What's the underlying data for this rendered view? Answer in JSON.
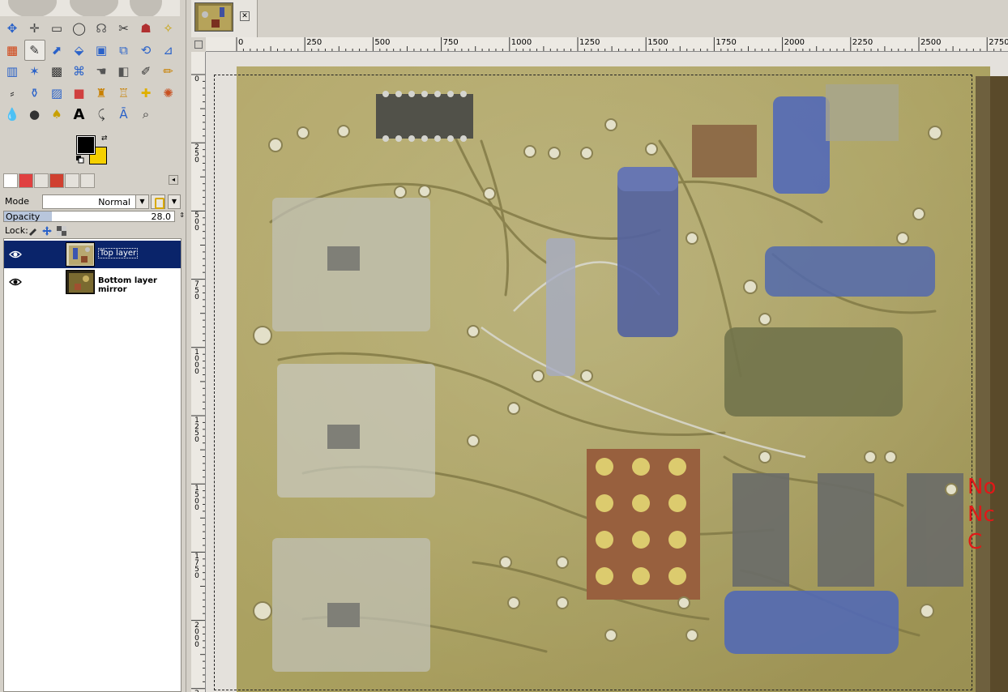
{
  "toolbox": {
    "tools": [
      {
        "name": "move-icon",
        "glyph": "✥",
        "color": "#2a62c9"
      },
      {
        "name": "align-icon",
        "glyph": "✛",
        "color": "#444"
      },
      {
        "name": "rect-select-icon",
        "glyph": "▭",
        "color": "#333"
      },
      {
        "name": "ellipse-select-icon",
        "glyph": "◯",
        "color": "#333"
      },
      {
        "name": "free-select-icon",
        "glyph": "☊",
        "color": "#555"
      },
      {
        "name": "scissors-icon",
        "glyph": "✂",
        "color": "#333"
      },
      {
        "name": "fg-select-icon",
        "glyph": "☗",
        "color": "#b03030"
      },
      {
        "name": "fuzzy-select-icon",
        "glyph": "✧",
        "color": "#c8a000"
      },
      {
        "name": "select-by-color-icon",
        "glyph": "▦",
        "color": "#d04010"
      },
      {
        "name": "paths-icon",
        "glyph": "✎",
        "color": "#333"
      },
      {
        "name": "color-picker-icon",
        "glyph": "⬈",
        "color": "#2a62c9"
      },
      {
        "name": "zoom-tool-icon",
        "glyph": "⬙",
        "color": "#2a62c9"
      },
      {
        "name": "measure-icon",
        "glyph": "▣",
        "color": "#2a62c9"
      },
      {
        "name": "crop-icon",
        "glyph": "⧉",
        "color": "#2a62c9"
      },
      {
        "name": "rotate-icon",
        "glyph": "⟲",
        "color": "#2a62c9"
      },
      {
        "name": "scale-icon",
        "glyph": "⊿",
        "color": "#2a62c9"
      },
      {
        "name": "shear-icon",
        "glyph": "▥",
        "color": "#2a62c9"
      },
      {
        "name": "perspective-icon",
        "glyph": "✶",
        "color": "#2a62c9"
      },
      {
        "name": "checker-icon",
        "glyph": "▩",
        "color": "#333"
      },
      {
        "name": "cage-icon",
        "glyph": "⌘",
        "color": "#2a62c9"
      },
      {
        "name": "warp-icon",
        "glyph": "☚",
        "color": "#555"
      },
      {
        "name": "gradient-icon",
        "glyph": "◧",
        "color": "#555"
      },
      {
        "name": "brush-icon",
        "glyph": "✐",
        "color": "#333"
      },
      {
        "name": "pencil-icon",
        "glyph": "✏",
        "color": "#c88000"
      },
      {
        "name": "airbrush-icon",
        "glyph": "⸗",
        "color": "#333"
      },
      {
        "name": "ink-icon",
        "glyph": "⚱",
        "color": "#2a62c9"
      },
      {
        "name": "mypaint-icon",
        "glyph": "▨",
        "color": "#2a62c9"
      },
      {
        "name": "eraser-icon",
        "glyph": "■",
        "color": "#d04040"
      },
      {
        "name": "clone-icon",
        "glyph": "♜",
        "color": "#c88000"
      },
      {
        "name": "heal-icon",
        "glyph": "♖",
        "color": "#c88000"
      },
      {
        "name": "bandage-icon",
        "glyph": "✚",
        "color": "#e0b000"
      },
      {
        "name": "smudge-icon",
        "glyph": "✺",
        "color": "#c85020"
      },
      {
        "name": "blur-icon",
        "glyph": "💧",
        "color": "#2a62c9"
      },
      {
        "name": "dodge-icon",
        "glyph": "●",
        "color": "#333"
      },
      {
        "name": "fuzzy-icon",
        "glyph": "♠",
        "color": "#c8a000"
      },
      {
        "name": "text-tool-icon",
        "glyph": "A",
        "color": "#000"
      },
      {
        "name": "color-pick-icon",
        "glyph": "⤹",
        "color": "#333"
      },
      {
        "name": "paths-text-icon",
        "glyph": "Ā",
        "color": "#2a62c9"
      },
      {
        "name": "magnify-icon",
        "glyph": "⌕",
        "color": "#333"
      }
    ],
    "fg_color": "#000000",
    "bg_color": "#f5d000"
  },
  "layers_panel": {
    "mode_label": "Mode",
    "mode_value": "Normal",
    "opacity_label": "Opacity",
    "opacity_value": "28.0",
    "opacity_fraction": 0.28,
    "lock_label": "Lock:",
    "layers": [
      {
        "name": "Top layer",
        "selected": true,
        "visible": true
      },
      {
        "name": "Bottom layer mirror",
        "selected": false,
        "visible": true
      }
    ]
  },
  "rulers": {
    "h_labels": [
      "0",
      "250",
      "500",
      "750",
      "1000",
      "1250",
      "1500",
      "1750",
      "2000",
      "2250",
      "2500",
      "2750"
    ],
    "v_labels": [
      "0",
      "250",
      "500",
      "750",
      "1000",
      "1250",
      "1500",
      "1750",
      "2000",
      "2250"
    ]
  },
  "canvas": {
    "note_lines": [
      "No",
      "Nc",
      "C"
    ]
  }
}
